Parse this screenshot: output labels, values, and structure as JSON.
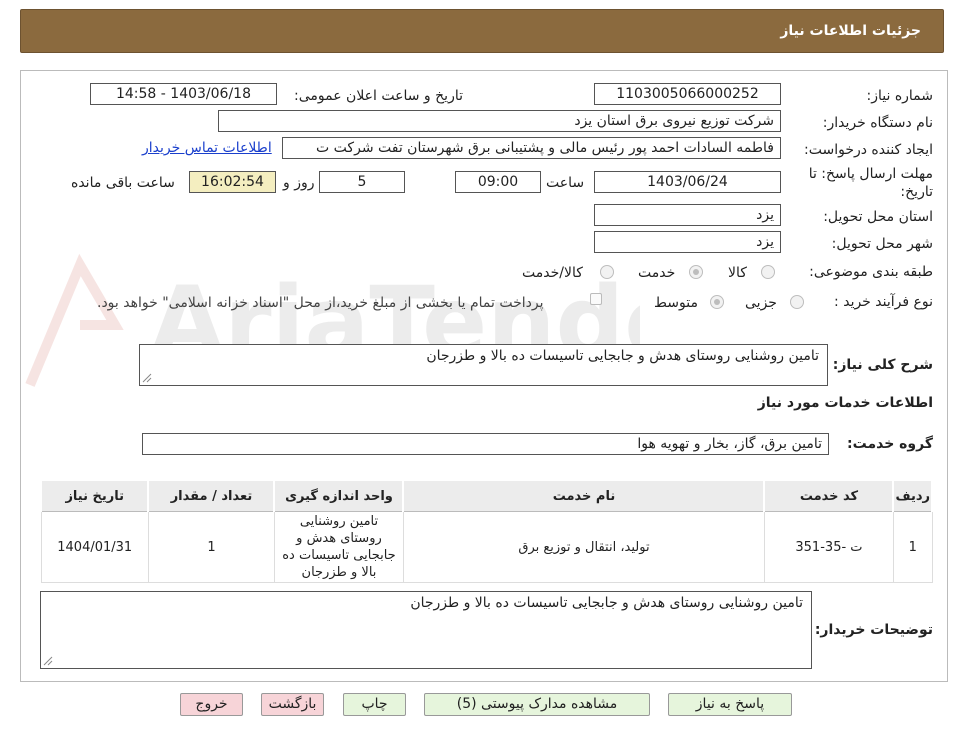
{
  "header": {
    "title": "جزئیات اطلاعات نیاز"
  },
  "form": {
    "need_number_label": "شماره نیاز:",
    "need_number": "1103005066000252",
    "announce_label": "تاریخ و ساعت اعلان عمومی:",
    "announce_value": "1403/06/18 - 14:58",
    "buyer_org_label": "نام دستگاه خریدار:",
    "buyer_org": "شرکت توزیع نیروی برق استان یزد",
    "creator_label": "ایجاد کننده درخواست:",
    "creator": "فاطمه السادات  احمد پور  رئیس مالی و پشتیبانی برق شهرستان تفت شرکت ت",
    "contact_link": "اطلاعات تماس خریدار",
    "deadline_label_1": "مهلت ارسال پاسخ: تا",
    "deadline_label_2": "تاریخ:",
    "deadline_date": "1403/06/24",
    "time_label": "ساعت",
    "deadline_time": "09:00",
    "days": "5",
    "days_label": "روز و",
    "remaining_time": "16:02:54",
    "remaining_label": "ساعت باقی مانده",
    "province_label": "استان محل تحویل:",
    "province": "یزد",
    "city_label": "شهر محل تحویل:",
    "city": "یزد",
    "category_label": "طبقه بندی موضوعی:",
    "category_options": [
      "کالا",
      "خدمت",
      "کالا/خدمت"
    ],
    "category_selected": "خدمت",
    "process_label": "نوع فرآیند خرید :",
    "process_options": [
      "جزیی",
      "متوسط"
    ],
    "process_selected": "متوسط",
    "payment_note": "پرداخت تمام یا بخشی از مبلغ خرید،از محل \"اسناد خزانه اسلامی\" خواهد بود.",
    "summary_label": "شرح کلی نیاز:",
    "summary": "تامین روشنایی روستای هدش و جابجایی تاسیسات ده بالا و طزرجان",
    "services_title": "اطلاعات خدمات مورد نیاز",
    "service_group_label": "گروه خدمت:",
    "service_group": "تامین برق، گاز، بخار و تهویه هوا"
  },
  "table": {
    "headers": [
      "ردیف",
      "کد خدمت",
      "نام خدمت",
      "واحد اندازه گیری",
      "تعداد / مقدار",
      "تاریخ نیاز"
    ],
    "rows": [
      [
        "1",
        "ت -35-351",
        "تولید، انتقال و توزیع برق",
        "تامین روشنایی روستای هدش و جابجایی تاسیسات ده بالا و طزرجان",
        "1",
        "1404/01/31"
      ]
    ]
  },
  "buyer_notes": {
    "label": "توضیحات خریدار:",
    "value": "تامین روشنایی روستای هدش و جابجایی تاسیسات ده بالا و طزرجان"
  },
  "buttons": {
    "reply": "پاسخ به نیاز",
    "attachments": "مشاهده مدارک پیوستی (5)",
    "print": "چاپ",
    "back": "بازگشت",
    "exit": "خروج"
  },
  "watermark": {
    "text": "AriaTender.neT"
  },
  "colors": {
    "header": "#8b6a3e",
    "time_box": "#f4eec0",
    "link": "#1a3fcc",
    "green_btn": "#e6f5dc",
    "pink_btn": "#f7d4d8"
  }
}
